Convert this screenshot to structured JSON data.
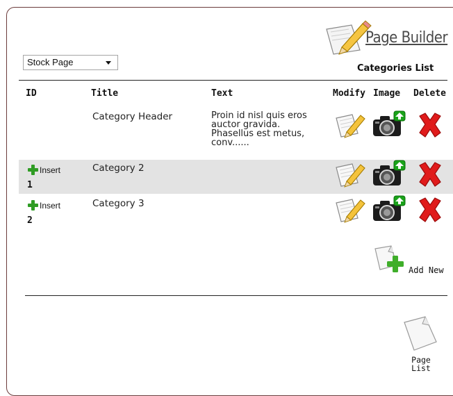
{
  "header": {
    "logo_text": "Page Builder",
    "page_select": {
      "selected": "Stock Page"
    },
    "section_title": "Categories List"
  },
  "table": {
    "columns": [
      "ID",
      "Title",
      "Text",
      "Modify",
      "Image",
      "Delete"
    ],
    "rows": [
      {
        "id": "",
        "insert_label": "",
        "title": "Category Header",
        "text": [
          "Proin id nisl quis eros",
          "auctor gravida.",
          "Phasellus est metus,",
          "conv......"
        ]
      },
      {
        "id": "1",
        "insert_label": "Insert",
        "title": "Category 2",
        "text": []
      },
      {
        "id": "2",
        "insert_label": "Insert",
        "title": "Category 3",
        "text": []
      }
    ]
  },
  "actions": {
    "add_new_label": "Add New",
    "page_list_label_line1": "Page",
    "page_list_label_line2": "List"
  },
  "colors": {
    "panel_border": "#6b3a3a",
    "highlight_row": "#e3e3e3",
    "insert_plus": "#2f9c24",
    "delete_red": "#e01b1b",
    "upload_green": "#1aa31a"
  },
  "icons": {
    "logo": "page-pencil-icon",
    "modify": "page-pencil-icon",
    "image": "camera-upload-icon",
    "delete": "red-x-icon",
    "add_new": "page-add-icon",
    "page_list": "page-icon"
  }
}
